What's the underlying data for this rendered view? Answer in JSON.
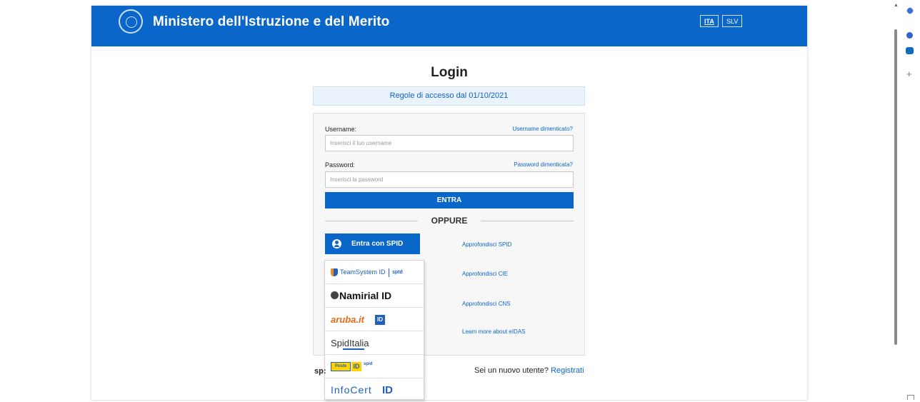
{
  "header": {
    "title": "Ministero dell'Istruzione e del Merito",
    "languages": [
      "ITA",
      "SLV"
    ]
  },
  "login": {
    "title": "Login",
    "rules_link": "Regole di accesso dal 01/10/2021",
    "username_label": "Username:",
    "username_forgot": "Username dimenticato?",
    "username_placeholder": "Inserisci il tuo username",
    "password_label": "Password:",
    "password_forgot": "Password dimenticata?",
    "password_placeholder": "Inserisci la password",
    "submit_label": "ENTRA",
    "or_label": "OPPURE",
    "spid_button": "Entra con SPID"
  },
  "info_links": {
    "spid": "Approfondisci SPID",
    "cie": "Approfondisci CIE",
    "cns": "Approfondisci CNS",
    "eidas": "Learn more about eIDAS"
  },
  "spid_providers": {
    "teamsystem": "TeamSystem ID",
    "teamsystem_spid": "sptd",
    "namirial": "Namirial ID",
    "aruba": "aruba.it",
    "aruba_id": "ID",
    "spiditalia": "SpidItalia",
    "poste": "Poste",
    "poste_id": "ID",
    "poste_spid": "spid",
    "infocert": "InfoCert",
    "infocert_id": "ID"
  },
  "bottom": {
    "left_text": "sp:",
    "new_user": "Sei un nuovo utente?",
    "register": "Registrati"
  }
}
